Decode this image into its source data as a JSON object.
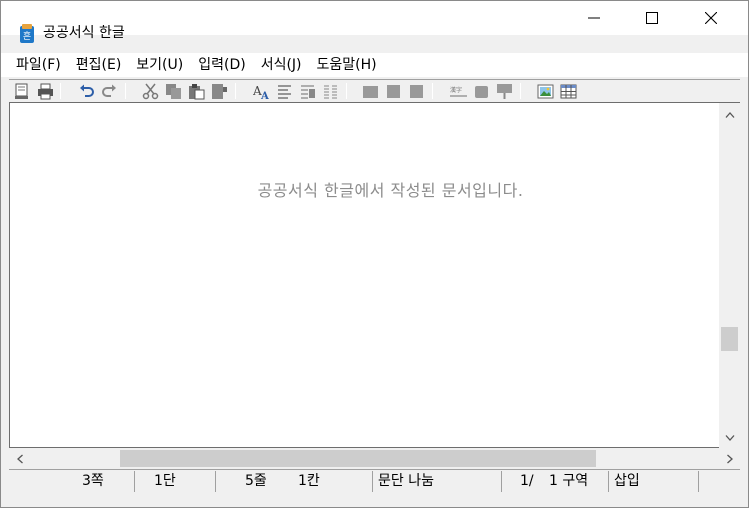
{
  "window": {
    "title": "공공서식 한글",
    "minimize_icon": "minimize-icon",
    "maximize_icon": "maximize-icon",
    "close_icon": "close-icon"
  },
  "menu": [
    {
      "label": "파일(F)"
    },
    {
      "label": "편집(E)"
    },
    {
      "label": "보기(U)"
    },
    {
      "label": "입력(D)"
    },
    {
      "label": "서식(J)"
    },
    {
      "label": "도움말(H)"
    }
  ],
  "toolbar": {
    "icons": [
      "preview-icon",
      "print-icon",
      "undo-icon",
      "redo-icon",
      "cut-icon",
      "copy-icon",
      "paste-icon",
      "format-paint-icon",
      "font-icon",
      "paragraph-icon",
      "style-icon",
      "column-icon",
      "align-left-block-icon",
      "align-center-block-icon",
      "align-right-block-icon",
      "hanja-icon",
      "shape-icon",
      "presentation-icon",
      "image-icon",
      "table-icon"
    ]
  },
  "document": {
    "text": "공공서식 한글에서 작성된 문서입니다."
  },
  "status": {
    "page": "3쪽",
    "column": "1단",
    "line": "5줄",
    "char": "1칸",
    "break": "문단 나눔",
    "page_of": "1/",
    "section": "1 구역",
    "mode": "삽입"
  },
  "colors": {
    "chrome": "#f0f0f0",
    "document_text": "#8c8c8c",
    "scroll_thumb": "#cdcdcd"
  }
}
